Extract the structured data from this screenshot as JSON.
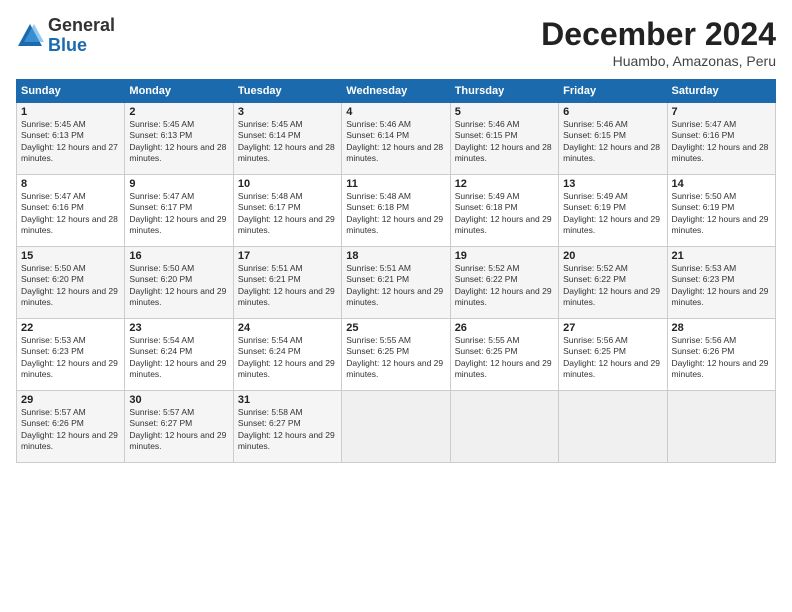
{
  "logo": {
    "general": "General",
    "blue": "Blue"
  },
  "title": "December 2024",
  "subtitle": "Huambo, Amazonas, Peru",
  "days_of_week": [
    "Sunday",
    "Monday",
    "Tuesday",
    "Wednesday",
    "Thursday",
    "Friday",
    "Saturday"
  ],
  "weeks": [
    [
      {
        "day": "1",
        "sunrise": "5:45 AM",
        "sunset": "6:13 PM",
        "daylight": "12 hours and 27 minutes."
      },
      {
        "day": "2",
        "sunrise": "5:45 AM",
        "sunset": "6:13 PM",
        "daylight": "12 hours and 28 minutes."
      },
      {
        "day": "3",
        "sunrise": "5:45 AM",
        "sunset": "6:14 PM",
        "daylight": "12 hours and 28 minutes."
      },
      {
        "day": "4",
        "sunrise": "5:46 AM",
        "sunset": "6:14 PM",
        "daylight": "12 hours and 28 minutes."
      },
      {
        "day": "5",
        "sunrise": "5:46 AM",
        "sunset": "6:15 PM",
        "daylight": "12 hours and 28 minutes."
      },
      {
        "day": "6",
        "sunrise": "5:46 AM",
        "sunset": "6:15 PM",
        "daylight": "12 hours and 28 minutes."
      },
      {
        "day": "7",
        "sunrise": "5:47 AM",
        "sunset": "6:16 PM",
        "daylight": "12 hours and 28 minutes."
      }
    ],
    [
      {
        "day": "8",
        "sunrise": "5:47 AM",
        "sunset": "6:16 PM",
        "daylight": "12 hours and 28 minutes."
      },
      {
        "day": "9",
        "sunrise": "5:47 AM",
        "sunset": "6:17 PM",
        "daylight": "12 hours and 29 minutes."
      },
      {
        "day": "10",
        "sunrise": "5:48 AM",
        "sunset": "6:17 PM",
        "daylight": "12 hours and 29 minutes."
      },
      {
        "day": "11",
        "sunrise": "5:48 AM",
        "sunset": "6:18 PM",
        "daylight": "12 hours and 29 minutes."
      },
      {
        "day": "12",
        "sunrise": "5:49 AM",
        "sunset": "6:18 PM",
        "daylight": "12 hours and 29 minutes."
      },
      {
        "day": "13",
        "sunrise": "5:49 AM",
        "sunset": "6:19 PM",
        "daylight": "12 hours and 29 minutes."
      },
      {
        "day": "14",
        "sunrise": "5:50 AM",
        "sunset": "6:19 PM",
        "daylight": "12 hours and 29 minutes."
      }
    ],
    [
      {
        "day": "15",
        "sunrise": "5:50 AM",
        "sunset": "6:20 PM",
        "daylight": "12 hours and 29 minutes."
      },
      {
        "day": "16",
        "sunrise": "5:50 AM",
        "sunset": "6:20 PM",
        "daylight": "12 hours and 29 minutes."
      },
      {
        "day": "17",
        "sunrise": "5:51 AM",
        "sunset": "6:21 PM",
        "daylight": "12 hours and 29 minutes."
      },
      {
        "day": "18",
        "sunrise": "5:51 AM",
        "sunset": "6:21 PM",
        "daylight": "12 hours and 29 minutes."
      },
      {
        "day": "19",
        "sunrise": "5:52 AM",
        "sunset": "6:22 PM",
        "daylight": "12 hours and 29 minutes."
      },
      {
        "day": "20",
        "sunrise": "5:52 AM",
        "sunset": "6:22 PM",
        "daylight": "12 hours and 29 minutes."
      },
      {
        "day": "21",
        "sunrise": "5:53 AM",
        "sunset": "6:23 PM",
        "daylight": "12 hours and 29 minutes."
      }
    ],
    [
      {
        "day": "22",
        "sunrise": "5:53 AM",
        "sunset": "6:23 PM",
        "daylight": "12 hours and 29 minutes."
      },
      {
        "day": "23",
        "sunrise": "5:54 AM",
        "sunset": "6:24 PM",
        "daylight": "12 hours and 29 minutes."
      },
      {
        "day": "24",
        "sunrise": "5:54 AM",
        "sunset": "6:24 PM",
        "daylight": "12 hours and 29 minutes."
      },
      {
        "day": "25",
        "sunrise": "5:55 AM",
        "sunset": "6:25 PM",
        "daylight": "12 hours and 29 minutes."
      },
      {
        "day": "26",
        "sunrise": "5:55 AM",
        "sunset": "6:25 PM",
        "daylight": "12 hours and 29 minutes."
      },
      {
        "day": "27",
        "sunrise": "5:56 AM",
        "sunset": "6:25 PM",
        "daylight": "12 hours and 29 minutes."
      },
      {
        "day": "28",
        "sunrise": "5:56 AM",
        "sunset": "6:26 PM",
        "daylight": "12 hours and 29 minutes."
      }
    ],
    [
      {
        "day": "29",
        "sunrise": "5:57 AM",
        "sunset": "6:26 PM",
        "daylight": "12 hours and 29 minutes."
      },
      {
        "day": "30",
        "sunrise": "5:57 AM",
        "sunset": "6:27 PM",
        "daylight": "12 hours and 29 minutes."
      },
      {
        "day": "31",
        "sunrise": "5:58 AM",
        "sunset": "6:27 PM",
        "daylight": "12 hours and 29 minutes."
      },
      null,
      null,
      null,
      null
    ]
  ],
  "labels": {
    "sunrise": "Sunrise:",
    "sunset": "Sunset:",
    "daylight": "Daylight:"
  }
}
